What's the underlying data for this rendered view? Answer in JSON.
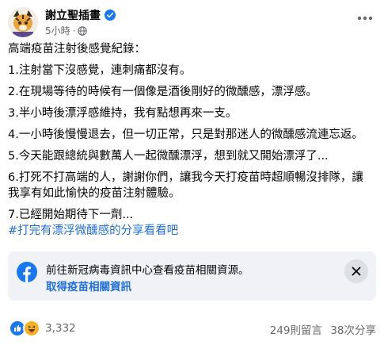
{
  "header": {
    "page_name": "謝立聖插畫",
    "time": "5小時",
    "separator": "·"
  },
  "post": {
    "lines": [
      "高端疫苗注射後感覺紀錄：",
      "1.注射當下沒感覺，連刺痛都沒有。",
      "2.在現場等待的時候有一個像是酒後剛好的微醺感，漂浮感。",
      "3.半小時後漂浮感維持，我有點想再來一支。",
      "4.一小時後慢慢退去，但一切正常，只是對那迷人的微醺感流連忘返。",
      "5.今天能跟總統與數萬人一起微醺漂浮，想到就又開始漂浮了...",
      "6.打死不打高端的人，謝謝你們，讓我今天打疫苗時超順暢沒排隊，讓",
      "我享有如此愉快的疫苗注射體驗。",
      "7.已經開始期待下一劑..."
    ],
    "hashtag": "#打完有漂浮微醺感的分享看看吧"
  },
  "info_card": {
    "text": "前往新冠病毒資訊中心查看疫苗相關資源。",
    "link": "取得疫苗相關資訊"
  },
  "footer": {
    "reaction_count": "3,332",
    "comments": "249則留言",
    "shares": "38次分享"
  },
  "colors": {
    "link_blue": "#216fdb",
    "verified_blue": "#1877f2",
    "like_blue": "#1877f2",
    "haha_yellow": "#f7b125",
    "card_bg": "#f0f2f5",
    "muted_gray": "#65676b"
  },
  "icons": [
    "avatar",
    "verified-badge-icon",
    "globe-icon",
    "more-options-icon",
    "facebook-logo-icon",
    "close-icon",
    "like-reaction-icon",
    "haha-reaction-icon"
  ]
}
